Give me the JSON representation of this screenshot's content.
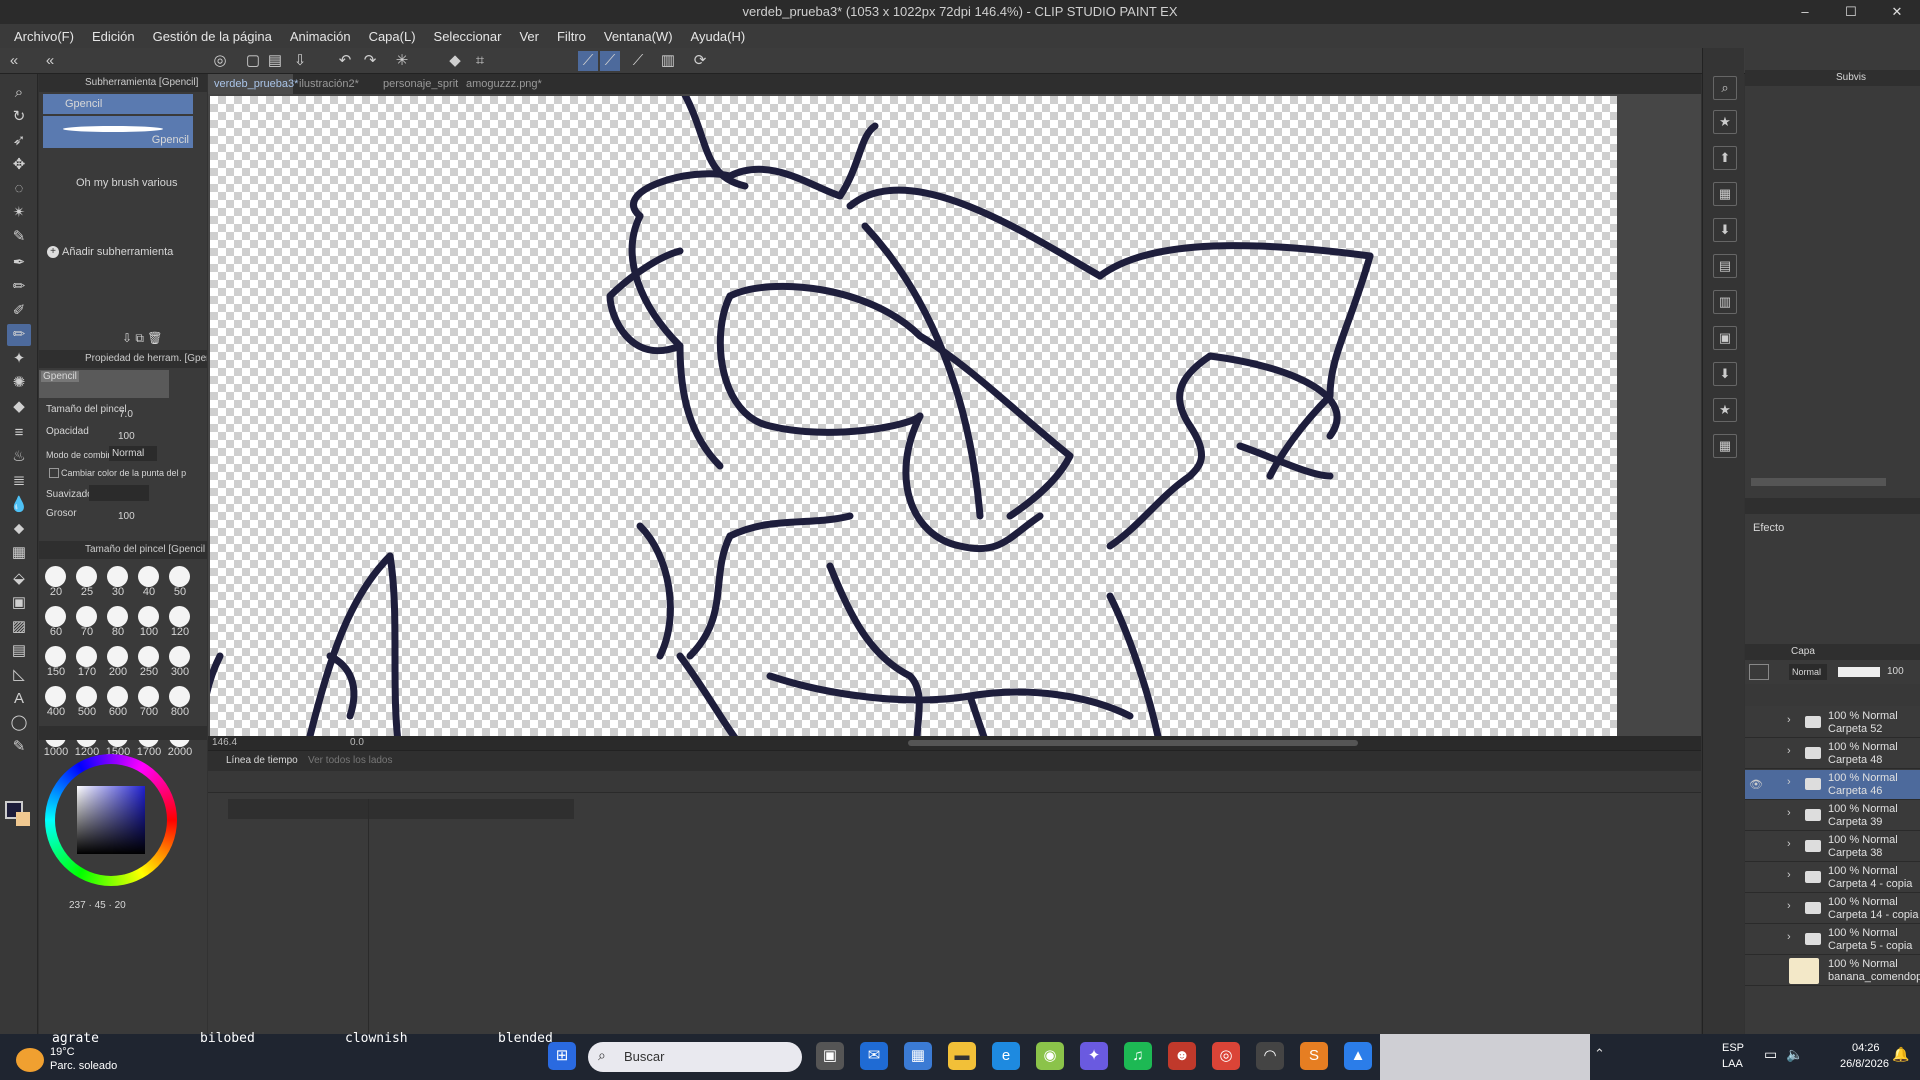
{
  "window": {
    "title": "verdeb_prueba3* (1053 x 1022px 72dpi 146.4%) - CLIP STUDIO PAINT EX",
    "controls": [
      "–",
      "☐",
      "✕"
    ]
  },
  "menu": [
    "Archivo(F)",
    "Edición",
    "Gestión de la página",
    "Animación",
    "Capa(L)",
    "Seleccionar",
    "Ver",
    "Filtro",
    "Ventana(W)",
    "Ayuda(H)"
  ],
  "subtool": {
    "header": "Subherramienta [Gpencil]",
    "selected": "Gpencil",
    "preview_label": "Gpencil",
    "group_label": "Oh my brush various",
    "add_label": "Añadir subherramienta"
  },
  "toolprop": {
    "header": "Propiedad de herram. [Gpen",
    "brush_name": "Gpencil",
    "size_label": "Tamaño del pincel",
    "size_value": "7.0",
    "opacity_label": "Opacidad",
    "opacity_value": "100",
    "blend_label": "Modo de combinac",
    "blend_value": "Normal",
    "tipcolor_label": "Cambiar color de la punta del p",
    "smooth_label": "Suavizado",
    "thickness_label": "Grosor",
    "thickness_value": "100"
  },
  "brushsize": {
    "header": "Tamaño del pincel [Gpencil",
    "sizes": [
      "20",
      "25",
      "30",
      "40",
      "50",
      "60",
      "70",
      "80",
      "100",
      "120",
      "150",
      "170",
      "200",
      "250",
      "300",
      "400",
      "500",
      "600",
      "700",
      "800",
      "1000",
      "1200",
      "1500",
      "1700",
      "2000"
    ]
  },
  "color": {
    "readout": [
      "237",
      "45",
      "20"
    ],
    "main_color": "#1c1c3a",
    "sub_color": "#f0c890"
  },
  "tabs": [
    {
      "label": "verdeb_prueba3*",
      "active": true
    },
    {
      "label": "ilustración2*",
      "active": false
    },
    {
      "label": "personaje_sprit",
      "active": false
    },
    {
      "label": "amoguzzz.png*",
      "active": false
    }
  ],
  "canvas_status": {
    "zoom": "146.4",
    "angle": "0.0"
  },
  "timeline": {
    "tab_label": "Línea de tiempo",
    "tab2_label": "Ver todos los lados"
  },
  "right": {
    "subview_label": "Subvis",
    "effect_label": "Efecto",
    "layer_tab": "Capa",
    "blend_mode": "Normal",
    "opacity": "100",
    "layers": [
      {
        "line1": "100 % Normal",
        "line2": "Carpeta 52",
        "selected": false,
        "type": "folder"
      },
      {
        "line1": "100 % Normal",
        "line2": "Carpeta 48",
        "selected": false,
        "type": "folder"
      },
      {
        "line1": "100 % Normal",
        "line2": "Carpeta 46",
        "selected": true,
        "type": "folder"
      },
      {
        "line1": "100 % Normal",
        "line2": "Carpeta 39",
        "selected": false,
        "type": "folder"
      },
      {
        "line1": "100 % Normal",
        "line2": "Carpeta 38",
        "selected": false,
        "type": "folder"
      },
      {
        "line1": "100 % Normal",
        "line2": "Carpeta 4 - copia",
        "selected": false,
        "type": "folder"
      },
      {
        "line1": "100 % Normal",
        "line2": "Carpeta 14 - copia",
        "selected": false,
        "type": "folder"
      },
      {
        "line1": "100 % Normal",
        "line2": "Carpeta 5 - copia",
        "selected": false,
        "type": "folder"
      },
      {
        "line1": "100 % Normal",
        "line2": "banana_comendop",
        "selected": false,
        "type": "image"
      }
    ]
  },
  "taskbar": {
    "weather_temp": "19°C",
    "weather_desc": "Parc. soleado",
    "search_placeholder": "Buscar",
    "overlay_words": [
      "agrate",
      "bilobed",
      "clownish",
      "blended"
    ],
    "lang1": "ESP",
    "lang2": "LAA",
    "time": "04:26",
    "date": "26/8/2026"
  }
}
